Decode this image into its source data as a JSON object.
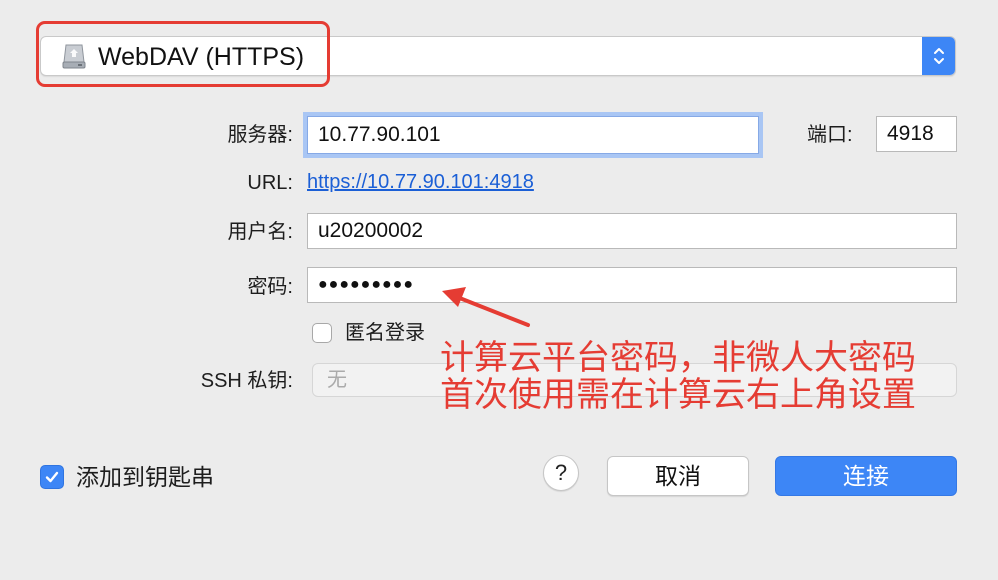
{
  "protocol": {
    "selected": "WebDAV (HTTPS)",
    "icon": "network-drive-icon"
  },
  "form": {
    "server_label": "服务器:",
    "server_value": "10.77.90.101",
    "port_label": "端口:",
    "port_value": "4918",
    "url_label": "URL:",
    "url_value": "https://10.77.90.101:4918",
    "username_label": "用户名:",
    "username_value": "u20200002",
    "password_label": "密码:",
    "password_value": "●●●●●●●●●",
    "anonymous_label": "匿名登录",
    "anonymous_checked": false,
    "ssh_label": "SSH 私钥:",
    "ssh_value": "无"
  },
  "footer": {
    "keychain_label": "添加到钥匙串",
    "keychain_checked": true,
    "help_label": "?",
    "cancel_label": "取消",
    "connect_label": "连接"
  },
  "annotation": {
    "line1": "计算云平台密码，非微人大密码",
    "line2": "首次使用需在计算云右上角设置",
    "color": "#e53c33"
  },
  "colors": {
    "accent": "#3d86f6",
    "link": "#1b5fd6"
  }
}
